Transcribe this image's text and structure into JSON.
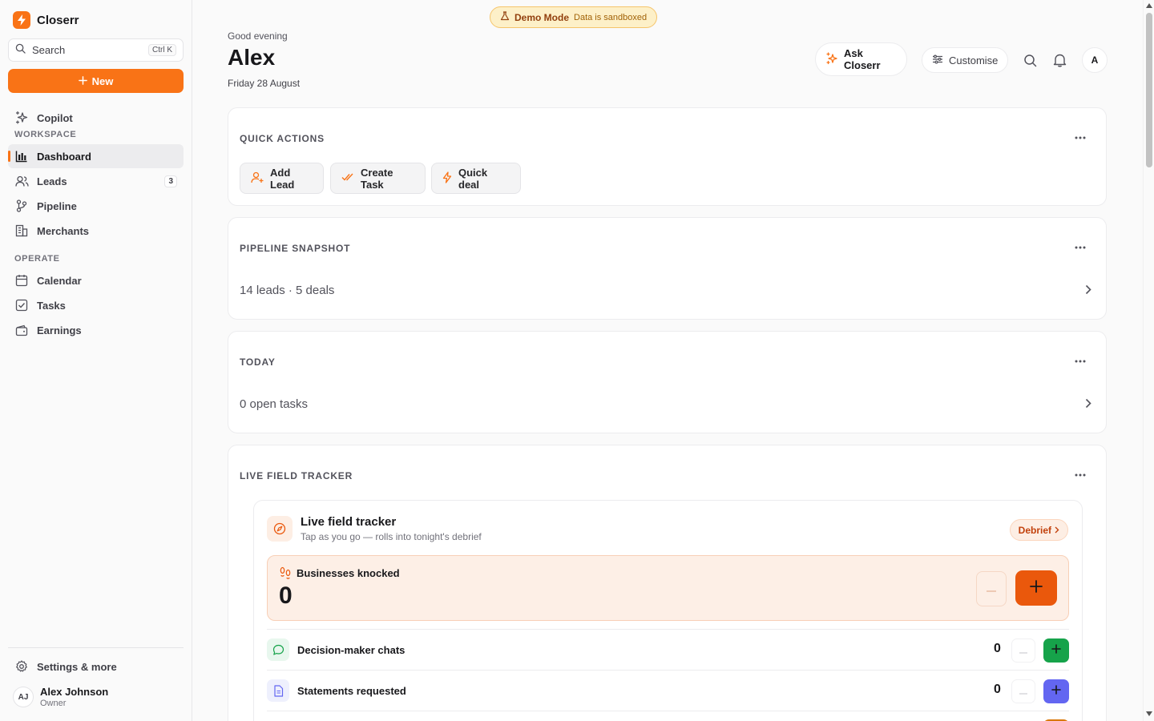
{
  "app": {
    "name": "Closerr"
  },
  "sidebar": {
    "search_label": "Search",
    "search_shortcut": "Ctrl K",
    "new_label": "New",
    "copilot_label": "Copilot",
    "workspace_label": "WORKSPACE",
    "operate_label": "OPERATE",
    "items": [
      {
        "label": "Dashboard",
        "icon": "bar-chart-icon"
      },
      {
        "label": "Leads",
        "icon": "users-icon",
        "badge": "3"
      },
      {
        "label": "Pipeline",
        "icon": "git-branch-icon"
      },
      {
        "label": "Merchants",
        "icon": "building-icon"
      },
      {
        "label": "Calendar",
        "icon": "calendar-icon"
      },
      {
        "label": "Tasks",
        "icon": "checkbox-icon"
      },
      {
        "label": "Earnings",
        "icon": "wallet-icon"
      }
    ],
    "settings_label": "Settings & more",
    "user": {
      "initials": "AJ",
      "name": "Alex Johnson",
      "role": "Owner"
    }
  },
  "banner": {
    "title": "Demo Mode",
    "subtitle": "Data is sandboxed"
  },
  "header": {
    "greeting": "Good evening",
    "name": "Alex",
    "date": "Friday 28 August",
    "ask_label": "Ask Closerr",
    "customise_label": "Customise",
    "avatar_initial": "A"
  },
  "quick_actions": {
    "title": "QUICK ACTIONS",
    "buttons": [
      {
        "label": "Add Lead",
        "icon": "user-plus-icon"
      },
      {
        "label": "Create Task",
        "icon": "check-double-icon"
      },
      {
        "label": "Quick deal",
        "icon": "bolt-icon"
      }
    ]
  },
  "pipeline_snapshot": {
    "title": "PIPELINE SNAPSHOT",
    "summary": "14 leads · 5 deals"
  },
  "today": {
    "title": "TODAY",
    "summary": "0 open tasks"
  },
  "live_tracker": {
    "card_title": "LIVE FIELD TRACKER",
    "title": "Live field tracker",
    "subtitle": "Tap as you go — rolls into tonight's debrief",
    "debrief_label": "Debrief",
    "primary": {
      "label": "Businesses knocked",
      "value": "0"
    },
    "rows": [
      {
        "label": "Decision-maker chats",
        "value": "0",
        "color": "#16a34a",
        "bg": "#e8f7ee",
        "icon": "chat-icon"
      },
      {
        "label": "Statements requested",
        "value": "0",
        "color": "#6366f1",
        "bg": "#eef0fd",
        "icon": "document-icon"
      }
    ]
  },
  "colors": {
    "accent": "#f97316",
    "accent_dark": "#ea580c"
  }
}
